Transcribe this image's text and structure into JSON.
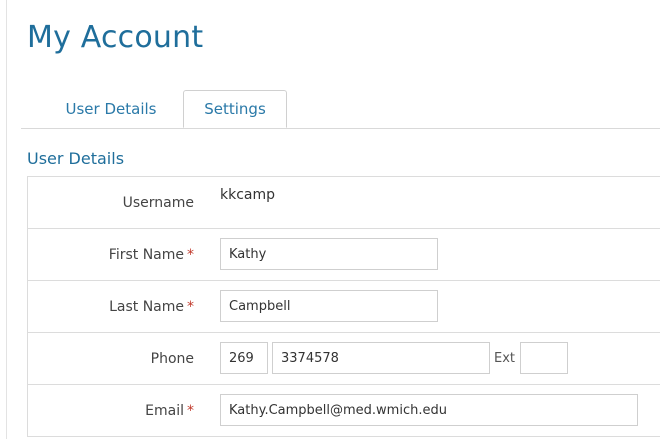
{
  "page": {
    "title": "My Account"
  },
  "tabs": [
    {
      "label": "User Details",
      "active": false
    },
    {
      "label": "Settings",
      "active": true
    }
  ],
  "section": {
    "title": "User Details"
  },
  "fields": {
    "username": {
      "label": "Username",
      "value": "kkcamp"
    },
    "first_name": {
      "label": "First Name",
      "value": "Kathy",
      "required_mark": "*"
    },
    "last_name": {
      "label": "Last Name",
      "value": "Campbell",
      "required_mark": "*"
    },
    "phone": {
      "label": "Phone",
      "area_code": "269",
      "number": "3374578",
      "ext_label": "Ext",
      "ext": ""
    },
    "email": {
      "label": "Email",
      "value": "Kathy.Campbell@med.wmich.edu",
      "required_mark": "*"
    }
  },
  "colors": {
    "accent": "#1f6e9b",
    "tab_text": "#2a79a8",
    "required": "#c0392b",
    "border": "#dcdcdc"
  }
}
